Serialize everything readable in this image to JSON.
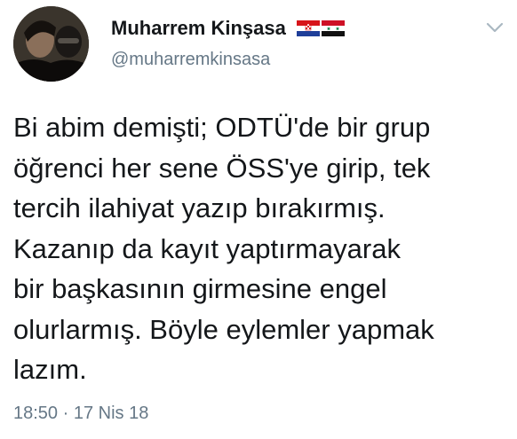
{
  "user": {
    "display_name": "Muharrem Kinşasa",
    "handle": "@muharremkinsasa",
    "flags": [
      "croatia-flag",
      "syria-flag"
    ]
  },
  "tweet": {
    "text": "Bi abim demişti; ODTÜ'de bir grup\nöğrenci her sene ÖSS'ye girip, tek\ntercih ilahiyat yazıp bırakırmış.\nKazanıp da kayıt yaptırmayarak\nbir başkasının girmesine engel\nolurlarmış. Böyle eylemler yapmak\nlazım.",
    "timestamp": "18:50 · 17 Nis 18"
  },
  "icons": {
    "menu": "chevron-down-icon"
  },
  "colors": {
    "text_primary": "#14171a",
    "text_secondary": "#657786",
    "chevron": "#aab8c2",
    "background": "#ffffff"
  }
}
